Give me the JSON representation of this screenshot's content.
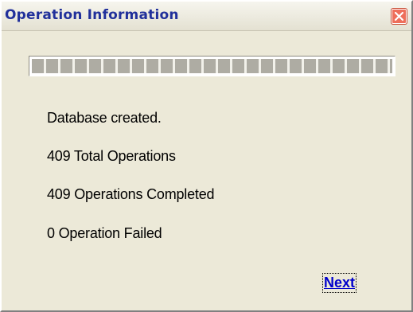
{
  "window": {
    "title": "Operation Information"
  },
  "progress": {
    "value": 1.0
  },
  "messages": {
    "status": "Database created.",
    "total": "409 Total Operations",
    "completed": "409 Operations Completed",
    "failed": "0 Operation Failed"
  },
  "actions": {
    "next_label": "Next"
  },
  "icons": {
    "close": "close-icon"
  },
  "colors": {
    "title_text": "#21309b",
    "close_button": "#ee6f5b",
    "link": "#0000cc"
  }
}
